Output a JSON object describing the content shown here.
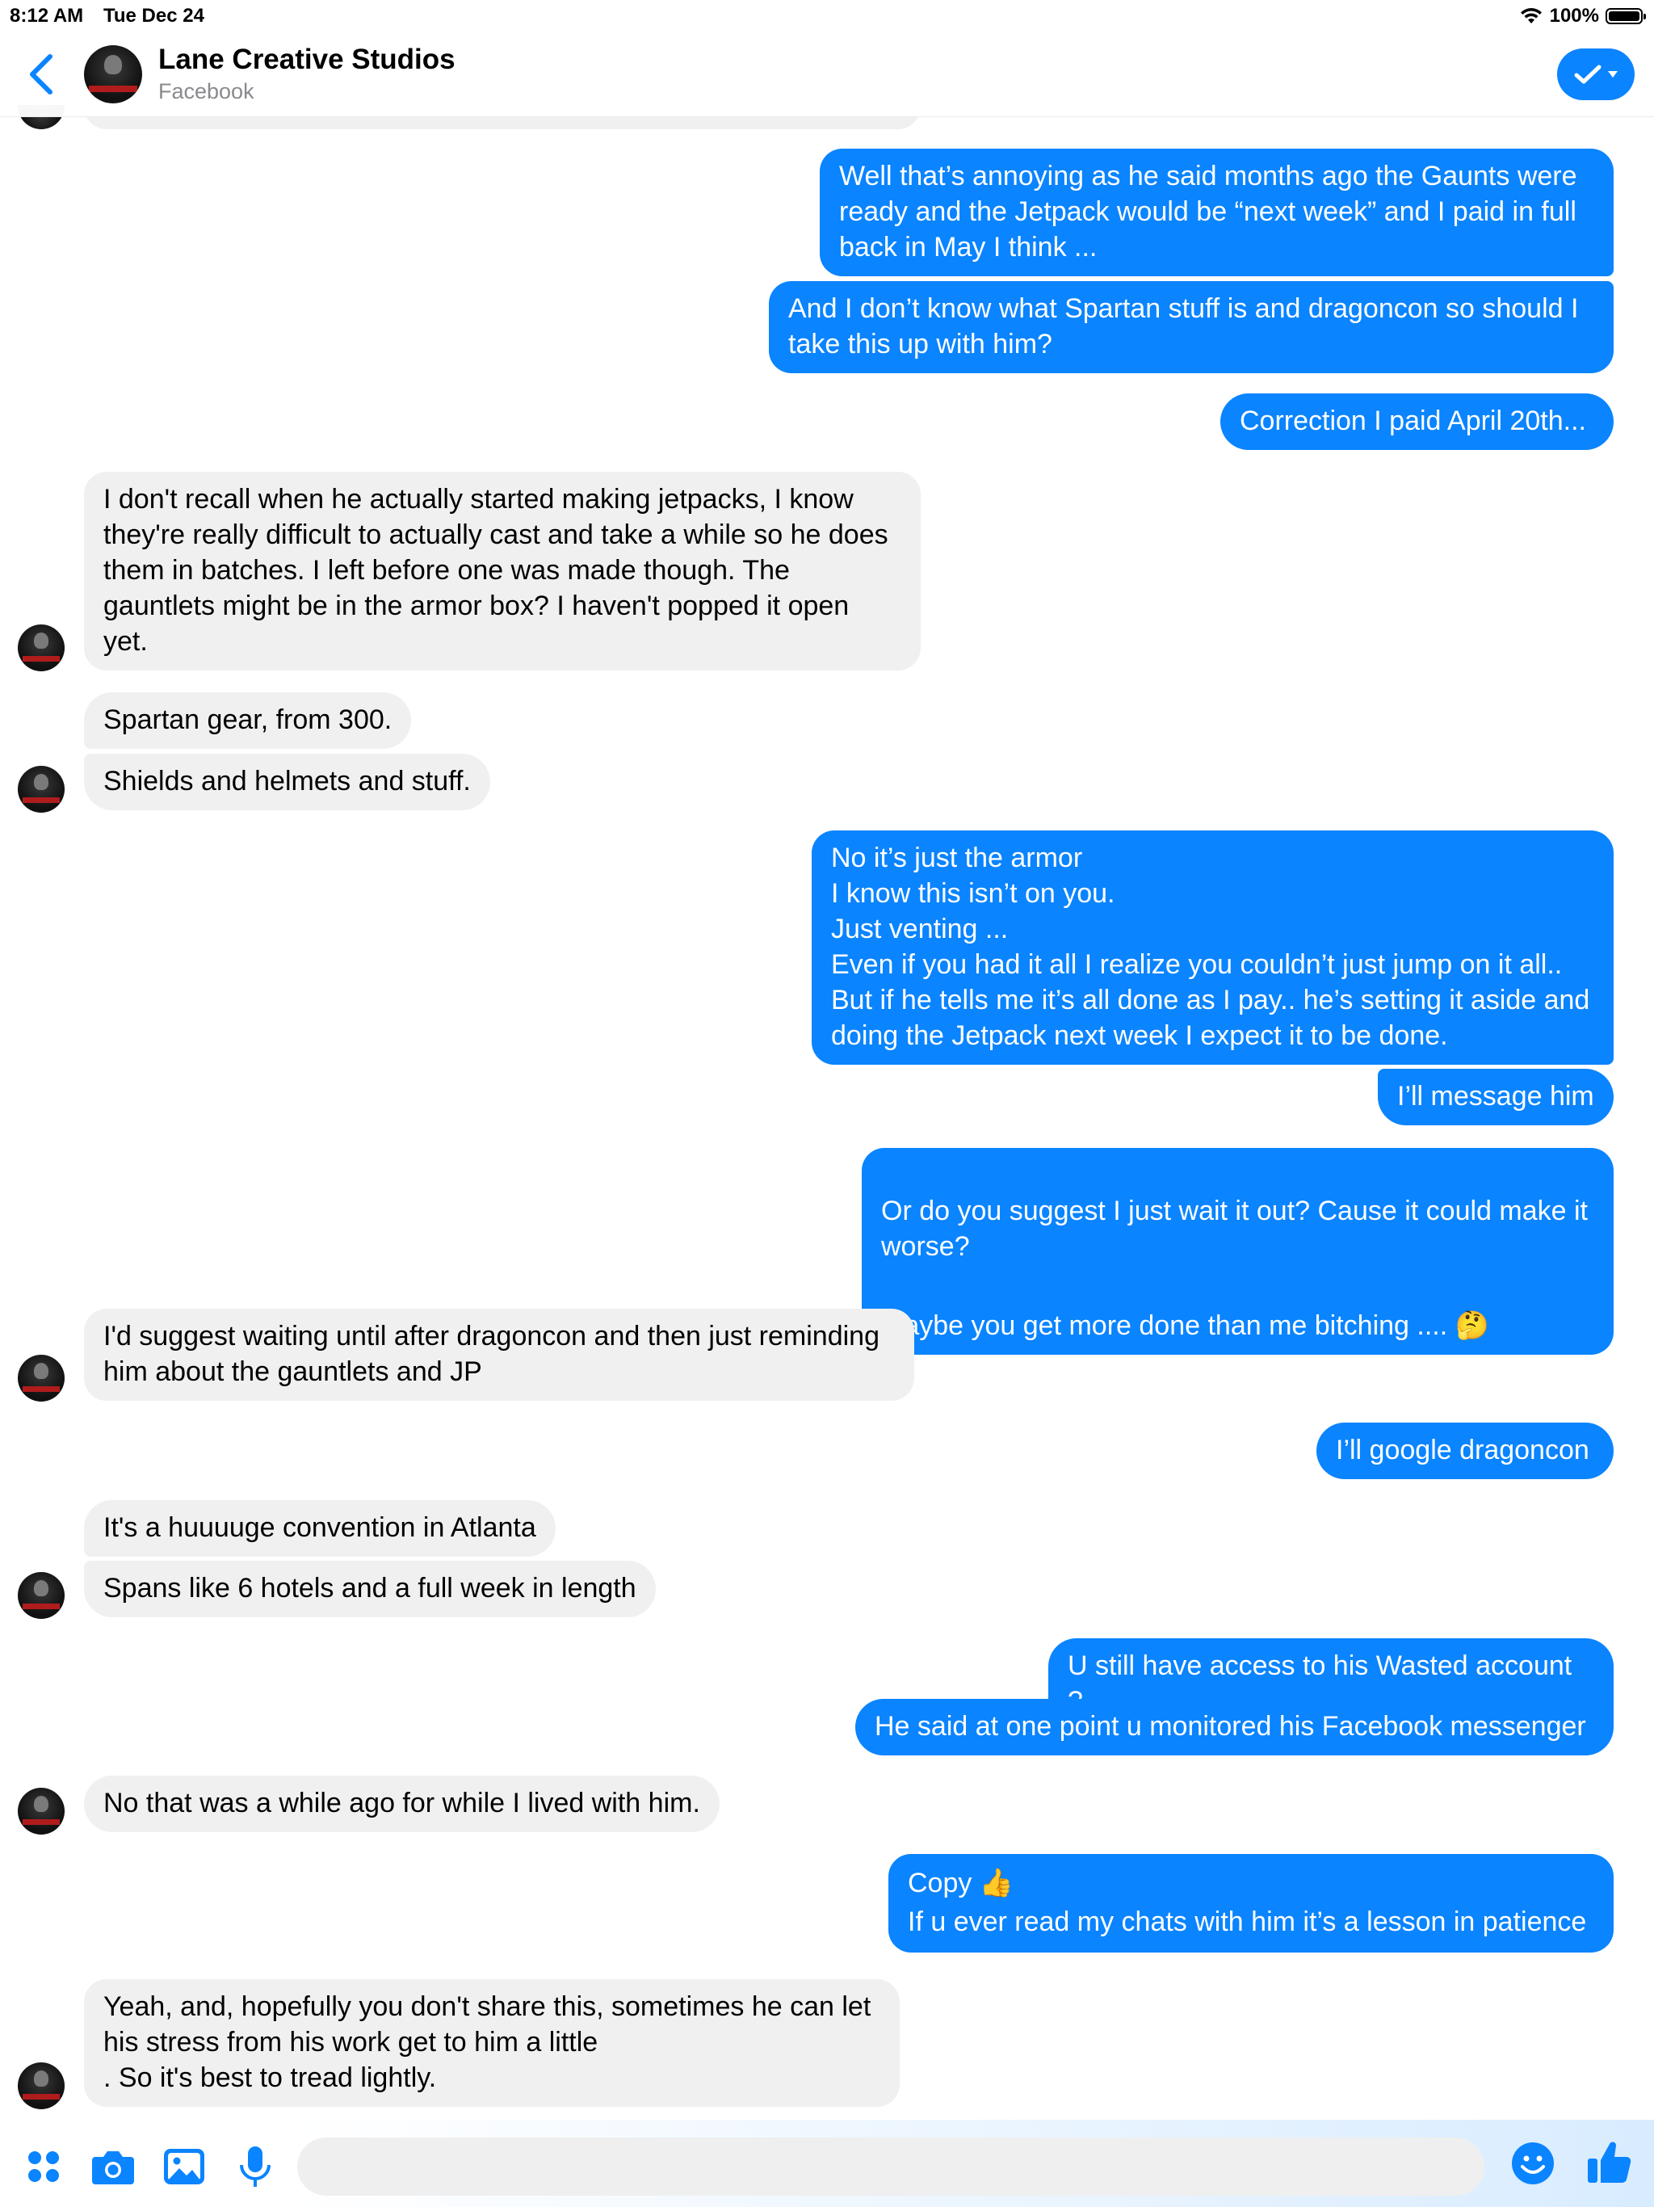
{
  "status_bar": {
    "time": "8:12 AM",
    "date": "Tue Dec 24",
    "battery": "100%"
  },
  "header": {
    "title": "Lane Creative Studios",
    "subtitle": "Facebook",
    "accent": "#0a84ff"
  },
  "messages": [
    {
      "dir": "out",
      "text": "Well that’s annoying as he said months ago the Gaunts were\nready and the Jetpack would be “next week” and I paid in full\nback in May I think ..."
    },
    {
      "dir": "out",
      "text": "And I don’t know what Spartan stuff is and dragoncon so should I\ntake this up with him?"
    },
    {
      "dir": "out",
      "text": "Correction I paid April 20th..."
    },
    {
      "dir": "in",
      "text": "I don't recall when he actually started making jetpacks, I know\nthey're really difficult to actually cast and take a while so he does\nthem in batches. I left before one was made though. The\ngauntlets might be in the armor box? I haven't popped it open\nyet."
    },
    {
      "dir": "in",
      "text": "Spartan gear, from 300."
    },
    {
      "dir": "in",
      "text": "Shields and helmets and stuff."
    },
    {
      "dir": "out",
      "text": "No it’s just the armor\nI know this isn’t on you.\nJust venting ...\nEven if you had it all I realize you couldn’t just jump on it all..\nBut if he tells me it’s all done as I pay.. he’s setting it aside and\ndoing the Jetpack next week I expect it to be done."
    },
    {
      "dir": "out",
      "text": "I’ll message him"
    },
    {
      "dir": "out",
      "text": "Or do you suggest I just wait it out? Cause it could make it\nworse?",
      "text2": "Maybe you get more done than me bitching .... 🤔"
    },
    {
      "dir": "in",
      "text": "I'd suggest waiting until after dragoncon and then just reminding\nhim about the gauntlets and JP"
    },
    {
      "dir": "out",
      "text": "I’ll google dragoncon"
    },
    {
      "dir": "in",
      "text": "It's a huuuuge convention in Atlanta"
    },
    {
      "dir": "in",
      "text": "Spans like 6 hotels and a full week in length"
    },
    {
      "dir": "out",
      "text": "U still have access to his Wasted account ?"
    },
    {
      "dir": "out",
      "text": "He said at one point u monitored his Facebook messenger"
    },
    {
      "dir": "in",
      "text": "No that was a while ago for while I lived with him."
    },
    {
      "dir": "out",
      "text": "Copy 👍\nIf u ever read my chats with him it’s a lesson in patience"
    },
    {
      "dir": "in",
      "text": "Yeah, and, hopefully you don't share this, sometimes he can let\nhis stress from his work get to him a little\n. So it's best to tread lightly."
    }
  ],
  "composer": {
    "placeholder": ""
  },
  "icons": [
    "back-chevron-icon",
    "checkmark-icon",
    "chevron-down-icon",
    "apps-icon",
    "camera-icon",
    "photo-icon",
    "microphone-icon",
    "emoji-icon",
    "thumbs-up-icon"
  ]
}
